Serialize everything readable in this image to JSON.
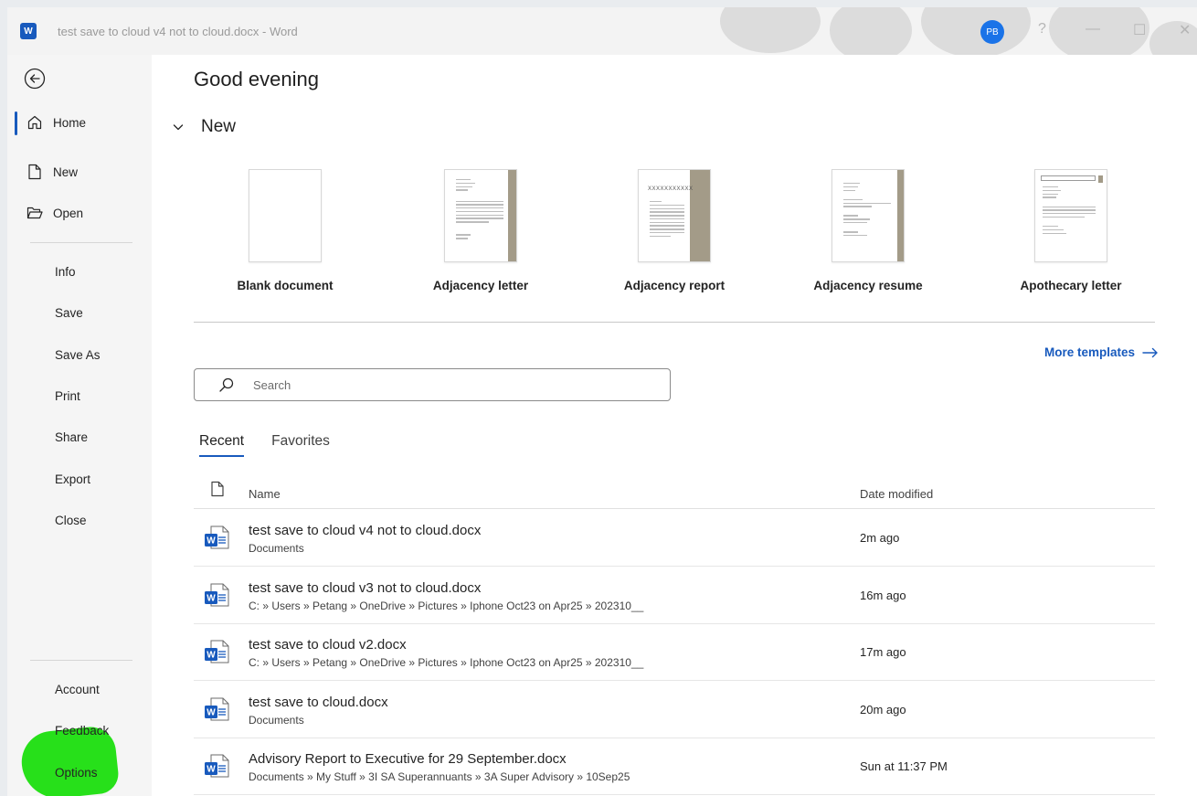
{
  "window": {
    "title": "test save to cloud v4 not to cloud.docx  -  Word",
    "app_icon_letter": "W",
    "avatar_initials": "PB",
    "help_glyph": "?",
    "minimize_glyph": "—",
    "maximize_glyph": "☐",
    "close_glyph": "✕"
  },
  "sidebar": {
    "primary": [
      {
        "label": "Home",
        "icon": "home-icon",
        "active": true
      },
      {
        "label": "New",
        "icon": "new-document-icon"
      },
      {
        "label": "Open",
        "icon": "folder-open-icon"
      }
    ],
    "secondary": [
      "Info",
      "Save",
      "Save As",
      "Print",
      "Share",
      "Export",
      "Close"
    ],
    "bottom": [
      "Account",
      "Feedback",
      "Options"
    ]
  },
  "main": {
    "greeting": "Good evening",
    "new_section_label": "New",
    "templates": [
      {
        "name": "Blank document",
        "type": "blank"
      },
      {
        "name": "Adjacency letter",
        "type": "letter"
      },
      {
        "name": "Adjacency report",
        "type": "report",
        "thumb_title": "XXXXXXXXXXX"
      },
      {
        "name": "Adjacency resume",
        "type": "resume"
      },
      {
        "name": "Apothecary letter",
        "type": "apothecary"
      }
    ],
    "more_templates": "More templates",
    "search_placeholder": "Search",
    "tabs": [
      {
        "label": "Recent",
        "active": true
      },
      {
        "label": "Favorites"
      }
    ],
    "columns": {
      "name": "Name",
      "date": "Date modified"
    },
    "files": [
      {
        "name": "test save to cloud v4 not to cloud.docx",
        "path": "Documents",
        "date": "2m ago"
      },
      {
        "name": "test save to cloud v3 not to cloud.docx",
        "path": "C: » Users » Petang » OneDrive » Pictures » Iphone Oct23 on Apr25 » 202310__",
        "date": "16m ago"
      },
      {
        "name": "test save to cloud v2.docx",
        "path": "C: » Users » Petang » OneDrive » Pictures » Iphone Oct23 on Apr25 » 202310__",
        "date": "17m ago"
      },
      {
        "name": "test save to cloud.docx",
        "path": "Documents",
        "date": "20m ago"
      },
      {
        "name": "Advisory Report to Executive for 29 September.docx",
        "path": "Documents » My Stuff » 3I SA Superannuants » 3A Super Advisory » 10Sep25",
        "date": "Sun at 11:37 PM"
      }
    ]
  },
  "colors": {
    "accent": "#185abd",
    "highlight_scribble": "#27e01a",
    "template_stripe": "#a39b88"
  }
}
